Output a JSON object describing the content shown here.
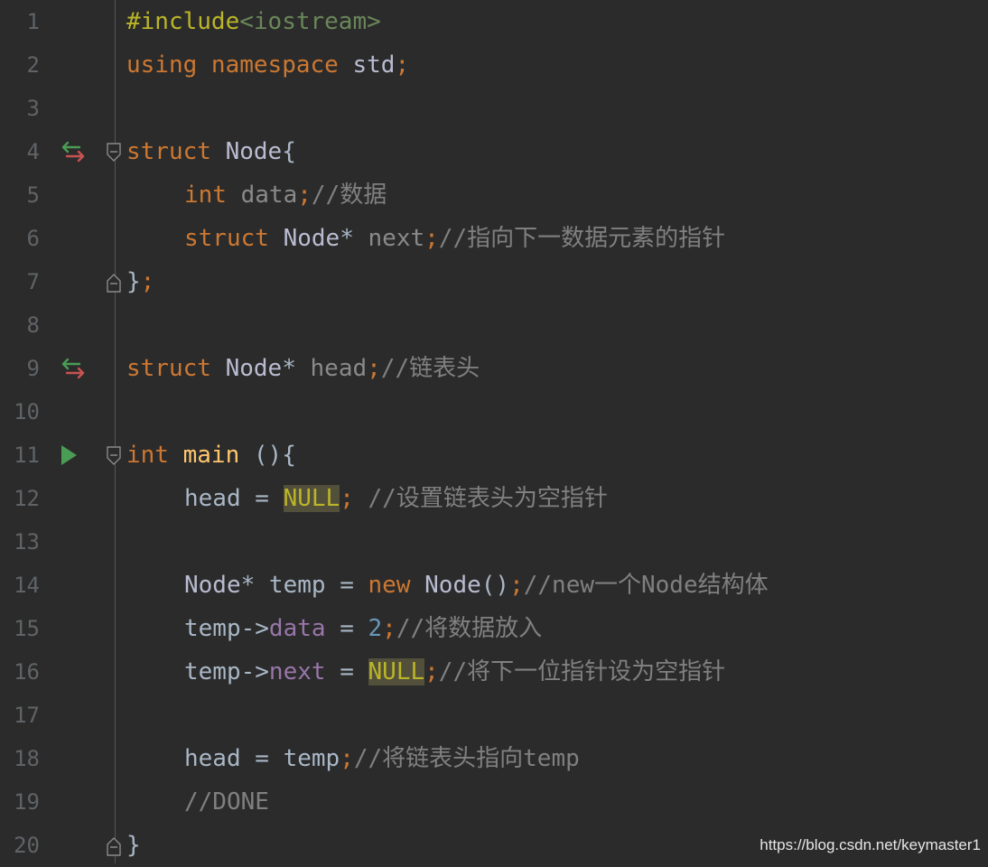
{
  "editor": {
    "lines": [
      {
        "num": "1",
        "tokens": [
          {
            "t": "#include",
            "c": "pp"
          },
          {
            "t": "<iostream>",
            "c": "inc"
          }
        ]
      },
      {
        "num": "2",
        "tokens": [
          {
            "t": "using ",
            "c": "kw"
          },
          {
            "t": "namespace ",
            "c": "kw"
          },
          {
            "t": "std",
            "c": "type"
          },
          {
            "t": ";",
            "c": "kw"
          }
        ]
      },
      {
        "num": "3",
        "tokens": []
      },
      {
        "num": "4",
        "marker": "override",
        "fold": "open",
        "tokens": [
          {
            "t": "struct ",
            "c": "kw"
          },
          {
            "t": "Node",
            "c": "type"
          },
          {
            "t": "{",
            "c": "plain"
          }
        ]
      },
      {
        "num": "5",
        "indent": 1,
        "tokens": [
          {
            "t": "int ",
            "c": "kw"
          },
          {
            "t": "data",
            "c": "var"
          },
          {
            "t": ";",
            "c": "kw"
          },
          {
            "t": "//数据",
            "c": "comment"
          }
        ]
      },
      {
        "num": "6",
        "indent": 1,
        "tokens": [
          {
            "t": "struct ",
            "c": "kw"
          },
          {
            "t": "Node",
            "c": "type"
          },
          {
            "t": "* ",
            "c": "plain"
          },
          {
            "t": "next",
            "c": "var"
          },
          {
            "t": ";",
            "c": "kw"
          },
          {
            "t": "//指向下一数据元素的指针",
            "c": "comment"
          }
        ]
      },
      {
        "num": "7",
        "fold": "close",
        "tokens": [
          {
            "t": "}",
            "c": "plain"
          },
          {
            "t": ";",
            "c": "kw"
          }
        ]
      },
      {
        "num": "8",
        "tokens": []
      },
      {
        "num": "9",
        "marker": "override",
        "tokens": [
          {
            "t": "struct ",
            "c": "kw"
          },
          {
            "t": "Node",
            "c": "type"
          },
          {
            "t": "* ",
            "c": "plain"
          },
          {
            "t": "head",
            "c": "var"
          },
          {
            "t": ";",
            "c": "kw"
          },
          {
            "t": "//链表头",
            "c": "comment"
          }
        ]
      },
      {
        "num": "10",
        "tokens": []
      },
      {
        "num": "11",
        "marker": "run",
        "fold": "open",
        "tokens": [
          {
            "t": "int ",
            "c": "kw"
          },
          {
            "t": "main ",
            "c": "fn"
          },
          {
            "t": "(){",
            "c": "plain"
          }
        ]
      },
      {
        "num": "12",
        "indent": 1,
        "tokens": [
          {
            "t": "head = ",
            "c": "plain"
          },
          {
            "t": "NULL",
            "c": "null"
          },
          {
            "t": "; ",
            "c": "kw"
          },
          {
            "t": "//设置链表头为空指针",
            "c": "comment"
          }
        ]
      },
      {
        "num": "13",
        "tokens": []
      },
      {
        "num": "14",
        "indent": 1,
        "tokens": [
          {
            "t": "Node",
            "c": "type"
          },
          {
            "t": "* temp = ",
            "c": "plain"
          },
          {
            "t": "new ",
            "c": "kw"
          },
          {
            "t": "Node",
            "c": "type"
          },
          {
            "t": "()",
            "c": "plain"
          },
          {
            "t": ";",
            "c": "kw"
          },
          {
            "t": "//new一个Node结构体",
            "c": "comment"
          }
        ]
      },
      {
        "num": "15",
        "indent": 1,
        "tokens": [
          {
            "t": "temp->",
            "c": "plain"
          },
          {
            "t": "data",
            "c": "field"
          },
          {
            "t": " = ",
            "c": "plain"
          },
          {
            "t": "2",
            "c": "num"
          },
          {
            "t": ";",
            "c": "kw"
          },
          {
            "t": "//将数据放入",
            "c": "comment"
          }
        ]
      },
      {
        "num": "16",
        "indent": 1,
        "tokens": [
          {
            "t": "temp->",
            "c": "plain"
          },
          {
            "t": "next",
            "c": "field"
          },
          {
            "t": " = ",
            "c": "plain"
          },
          {
            "t": "NULL",
            "c": "null"
          },
          {
            "t": ";",
            "c": "kw"
          },
          {
            "t": "//将下一位指针设为空指针",
            "c": "comment"
          }
        ]
      },
      {
        "num": "17",
        "tokens": []
      },
      {
        "num": "18",
        "indent": 1,
        "tokens": [
          {
            "t": "head = temp",
            "c": "plain"
          },
          {
            "t": ";",
            "c": "kw"
          },
          {
            "t": "//将链表头指向temp",
            "c": "comment"
          }
        ]
      },
      {
        "num": "19",
        "indent": 1,
        "tokens": [
          {
            "t": "//DONE",
            "c": "comment"
          }
        ]
      },
      {
        "num": "20",
        "fold": "close",
        "tokens": [
          {
            "t": "}",
            "c": "plain"
          }
        ]
      }
    ]
  },
  "watermark": "https://blog.csdn.net/keymaster1",
  "colors": {
    "background": "#2b2b2b",
    "keyword": "#cc7832",
    "comment": "#808080",
    "function": "#ffc66d",
    "preprocessor": "#bbb529",
    "include": "#6a8759",
    "field": "#9876aa",
    "number": "#6897bb",
    "run_marker": "#499c54",
    "override_marker_green": "#499c54",
    "override_marker_red": "#c75450"
  }
}
